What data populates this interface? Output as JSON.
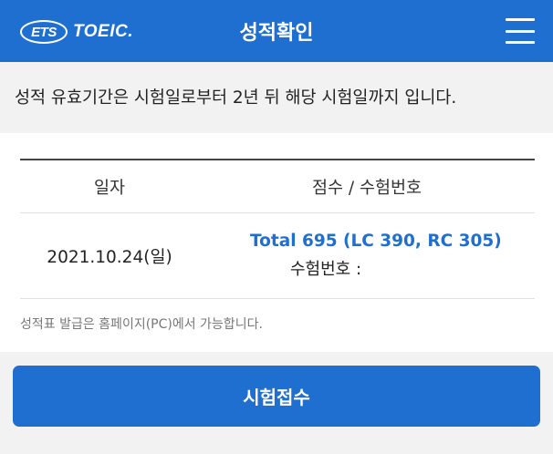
{
  "header": {
    "logo": {
      "ets": "ETS",
      "toeic": "TOEIC."
    },
    "title": "성적확인",
    "menu_icon": "hamburger-menu-icon"
  },
  "notice": "성적 유효기간은 시험일로부터 2년 뒤 해당 시험일까지 입니다.",
  "table": {
    "columns": [
      "일자",
      "점수 / 수험번호"
    ],
    "rows": [
      {
        "date": "2021.10.24(일)",
        "score": "Total 695 (LC 390, RC 305)",
        "exam_number_label": "수험번호 :"
      }
    ]
  },
  "footnote": "성적표 발급은 홈페이지(PC)에서 가능합니다.",
  "apply_button": "시험접수",
  "colors": {
    "brand_blue": "#1f6fd0",
    "background": "#f2f2f2"
  }
}
